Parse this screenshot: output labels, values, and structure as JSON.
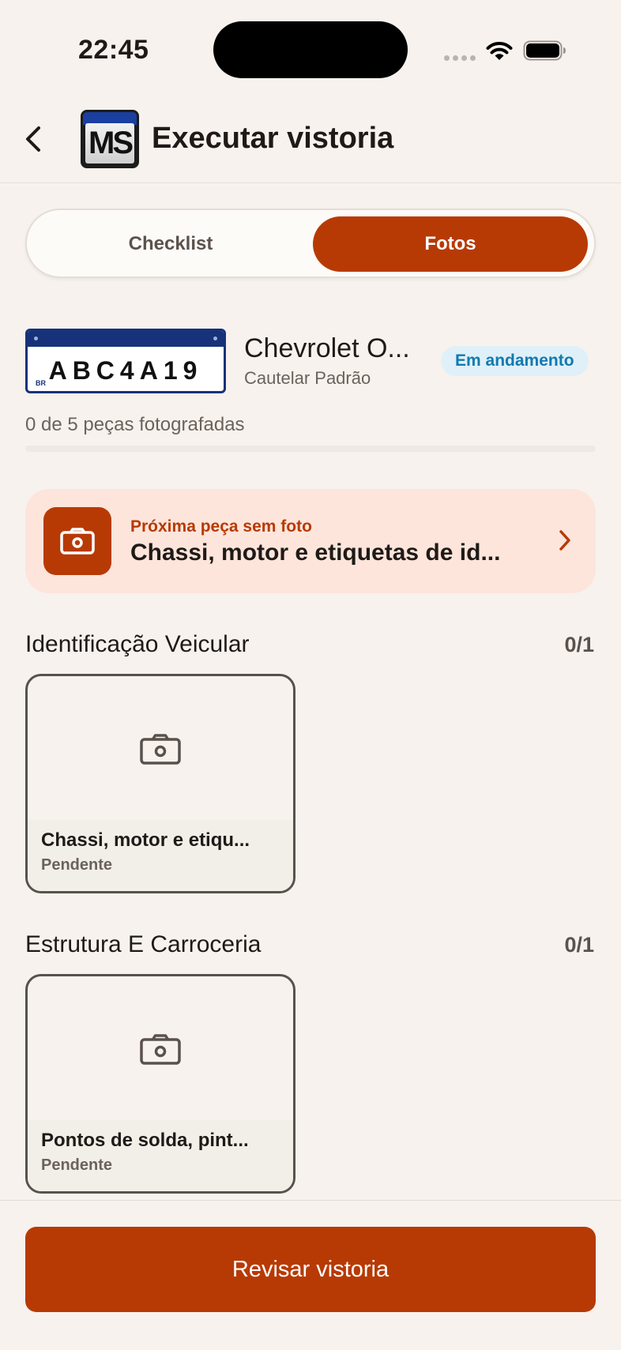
{
  "status_bar": {
    "time": "22:45"
  },
  "header": {
    "title": "Executar vistoria",
    "logo_text": "MS"
  },
  "tabs": [
    {
      "label": "Checklist",
      "active": false
    },
    {
      "label": "Fotos",
      "active": true
    }
  ],
  "vehicle": {
    "plate": "ABC4A19",
    "plate_country": "BR",
    "name": "Chevrolet O...",
    "type": "Cautelar Padrão",
    "status": "Em andamento"
  },
  "progress": {
    "text": "0 de 5 peças fotografadas",
    "fraction": 0
  },
  "next_card": {
    "label": "Próxima peça sem foto",
    "title": "Chassi, motor e etiquetas de id..."
  },
  "sections": [
    {
      "title": "Identificação Veicular",
      "count": "0/1",
      "items": [
        {
          "name": "Chassi, motor e etiqu...",
          "state": "Pendente"
        }
      ]
    },
    {
      "title": "Estrutura E Carroceria",
      "count": "0/1",
      "items": [
        {
          "name": "Pontos de solda, pint...",
          "state": "Pendente"
        }
      ]
    }
  ],
  "footer": {
    "button_label": "Revisar vistoria"
  },
  "colors": {
    "accent": "#b73a05",
    "background": "#f7f2ee",
    "badge_bg": "#dff0f9",
    "badge_text": "#0f7ab0"
  }
}
